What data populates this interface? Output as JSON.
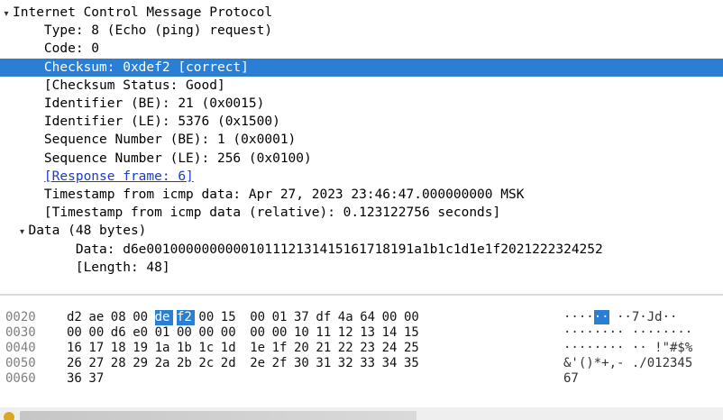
{
  "tree": {
    "rows": [
      {
        "indent": "",
        "arrow": "▾",
        "text": "Internet Control Message Protocol",
        "selected": false,
        "link": false
      },
      {
        "indent": "    ",
        "arrow": "",
        "text": "Type: 8 (Echo (ping) request)",
        "selected": false,
        "link": false
      },
      {
        "indent": "    ",
        "arrow": "",
        "text": "Code: 0",
        "selected": false,
        "link": false
      },
      {
        "indent": "    ",
        "arrow": "",
        "text": "Checksum: 0xdef2 [correct]",
        "selected": true,
        "link": false
      },
      {
        "indent": "    ",
        "arrow": "",
        "text": "[Checksum Status: Good]",
        "selected": false,
        "link": false
      },
      {
        "indent": "    ",
        "arrow": "",
        "text": "Identifier (BE): 21 (0x0015)",
        "selected": false,
        "link": false
      },
      {
        "indent": "    ",
        "arrow": "",
        "text": "Identifier (LE): 5376 (0x1500)",
        "selected": false,
        "link": false
      },
      {
        "indent": "    ",
        "arrow": "",
        "text": "Sequence Number (BE): 1 (0x0001)",
        "selected": false,
        "link": false
      },
      {
        "indent": "    ",
        "arrow": "",
        "text": "Sequence Number (LE): 256 (0x0100)",
        "selected": false,
        "link": false
      },
      {
        "indent": "    ",
        "arrow": "",
        "text": "[Response frame: 6]",
        "selected": false,
        "link": true
      },
      {
        "indent": "    ",
        "arrow": "",
        "text": "Timestamp from icmp data: Apr 27, 2023 23:46:47.000000000 MSK",
        "selected": false,
        "link": false
      },
      {
        "indent": "    ",
        "arrow": "",
        "text": "[Timestamp from icmp data (relative): 0.123122756 seconds]",
        "selected": false,
        "link": false
      },
      {
        "indent": "  ",
        "arrow": "▾",
        "text": "Data (48 bytes)",
        "selected": false,
        "link": false
      },
      {
        "indent": "        ",
        "arrow": "",
        "text": "Data: d6e0010000000000101112131415161718191a1b1c1d1e1f2021222324252",
        "selected": false,
        "link": false
      },
      {
        "indent": "        ",
        "arrow": "",
        "text": "[Length: 48]",
        "selected": false,
        "link": false
      }
    ]
  },
  "hex": {
    "rows": [
      {
        "offset": "0020",
        "bytes": [
          "d2",
          "ae",
          "08",
          "00",
          "de",
          "f2",
          "00",
          "15",
          "00",
          "01",
          "37",
          "df",
          "4a",
          "64",
          "00",
          "00"
        ],
        "highlight": [
          4,
          5
        ],
        "ascii": "······ ··7·Jd··"
      },
      {
        "offset": "0030",
        "bytes": [
          "00",
          "00",
          "d6",
          "e0",
          "01",
          "00",
          "00",
          "00",
          "00",
          "00",
          "10",
          "11",
          "12",
          "13",
          "14",
          "15"
        ],
        "highlight": [],
        "ascii": "········ ········"
      },
      {
        "offset": "0040",
        "bytes": [
          "16",
          "17",
          "18",
          "19",
          "1a",
          "1b",
          "1c",
          "1d",
          "1e",
          "1f",
          "20",
          "21",
          "22",
          "23",
          "24",
          "25"
        ],
        "highlight": [],
        "ascii": "········ ·· !\"#$%"
      },
      {
        "offset": "0050",
        "bytes": [
          "26",
          "27",
          "28",
          "29",
          "2a",
          "2b",
          "2c",
          "2d",
          "2e",
          "2f",
          "30",
          "31",
          "32",
          "33",
          "34",
          "35"
        ],
        "highlight": [],
        "ascii": "&'()*+,- ./012345"
      },
      {
        "offset": "0060",
        "bytes": [
          "36",
          "37"
        ],
        "highlight": [],
        "ascii": "67"
      }
    ]
  },
  "colors": {
    "selection": "#2a7fd4",
    "link": "#1a3cc8",
    "offset": "#7f7f7f"
  },
  "status": {
    "icon": "status-dot-icon"
  }
}
